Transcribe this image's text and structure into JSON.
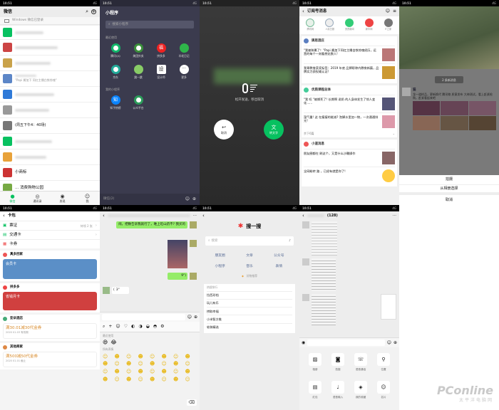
{
  "status": {
    "time": "10:51",
    "net": "4G"
  },
  "chats": {
    "title": "微信",
    "search_icon": "search-icon",
    "add_icon": "plus-icon",
    "banner": "Windows 微信已登录",
    "preview1": "\"Papi 酱加下 同红主播白铁惊魂\"",
    "preview2": "(周五下午4：40场)",
    "item_a": "小商标",
    "item_b": "... 消费购物公园",
    "tabs": [
      "微信",
      "通讯录",
      "发现",
      "我"
    ],
    "badge": "2"
  },
  "mini": {
    "title": "小程序",
    "search_placeholder": "搜索小程序",
    "recent_label": "最近使用",
    "mine_label": "我的小程序",
    "apps": [
      "腾讯QQ",
      "美团外卖",
      "拼多多",
      "羊毛日记",
      "京东",
      "跳一跳",
      "设计师",
      "更多"
    ],
    "row2": [
      "知乎热榜",
      "公众平台"
    ],
    "footer": "微信(2)"
  },
  "voice": {
    "hint": "松开发送，移出取消",
    "cancel": "取消",
    "send": "转文字"
  },
  "subs": {
    "title": "订阅号消息",
    "apps": [
      "腾讯网",
      "人民日报",
      "央视新闻",
      "新华网",
      "IT之家"
    ],
    "acc1": "搞思酒庄",
    "a1": "\"我被装裹了！\"Papi 酱加下同红主播白铁惊魂经历，运营的每个一刻看想无数人!",
    "a2": "我哥教育获奖标签：2019 年底 品牌职称内教育新篇，品牌实力获权威认证!",
    "acc2": "优质课程总体",
    "a3": "\"我 叹 \"被撕死了! 长期啊 说奶 的人身体发生了惊人变化......",
    "a4": "湿气重! 这 在瘦瘦的能减? 泡脚水里加一物，一次通通排光!",
    "more": "余下6篇",
    "acc3": "小道消息",
    "a5": "朋友圈都在 刷这个，又是什么沙雕操作",
    "a6": "全网粉转 路 ，已经有就是你了!"
  },
  "moments": {
    "like_label": "2 条新消息",
    "post_name": "猫",
    "post_text": "龙一道样品，更新换代 腾讯物 质意发布 大神测试，看上赶紧抢购，赶紧看起来吧",
    "sheet": [
      "拍摄",
      "从相册选择",
      "取消"
    ]
  },
  "card": {
    "title": "卡包",
    "tickets": "票证",
    "tickets_count": "待领 2 张",
    "transit": "交通卡",
    "coupons": "卡券",
    "m1": "真多回家",
    "c1": "会员卡",
    "m2": "拼多多",
    "c2": "省钱月卡",
    "m3": "亚朵酒店",
    "c3": "满30.01减30代金券",
    "c3_sub": "2020 01.03 有效期",
    "m4": "其他商家",
    "c4": "满500减50代金券",
    "c4_sub": "2020 01.01 截止"
  },
  "chat": {
    "msg_text": "闹，把数告诉我就行了，唯上吃山药不? 我买的",
    "voice_sec": "3\"",
    "voice_out": "9\"",
    "recent_label": "最近使用",
    "all_label": "所有表情"
  },
  "sousou": {
    "title": "搜一搜",
    "placeholder": "搜索",
    "cats": [
      "朋友圈",
      "文章",
      "公众号",
      "小程序",
      "音乐",
      "表情"
    ],
    "trend": "好物推荐",
    "hot_label": "热搜排行",
    "hot": [
      "拉西珍档",
      "玩儿有乐",
      "捞取幸福",
      "小米智方推",
      "软装精选"
    ]
  },
  "group": {
    "title": "(128)",
    "tools": [
      "相册",
      "拍摄",
      "语音通话",
      "位置",
      "红包",
      "语音输入",
      "我的收藏",
      "名片"
    ]
  },
  "watermark": {
    "brand": "PConline",
    "sub": "太平洋电脑网"
  },
  "colors": {
    "wechat_green": "#07c160",
    "mini_bg": "#3b3b4e",
    "voice_bg": "#2e2e2e",
    "card_blue": "#5b8fc7",
    "card_red": "#d0403f"
  }
}
